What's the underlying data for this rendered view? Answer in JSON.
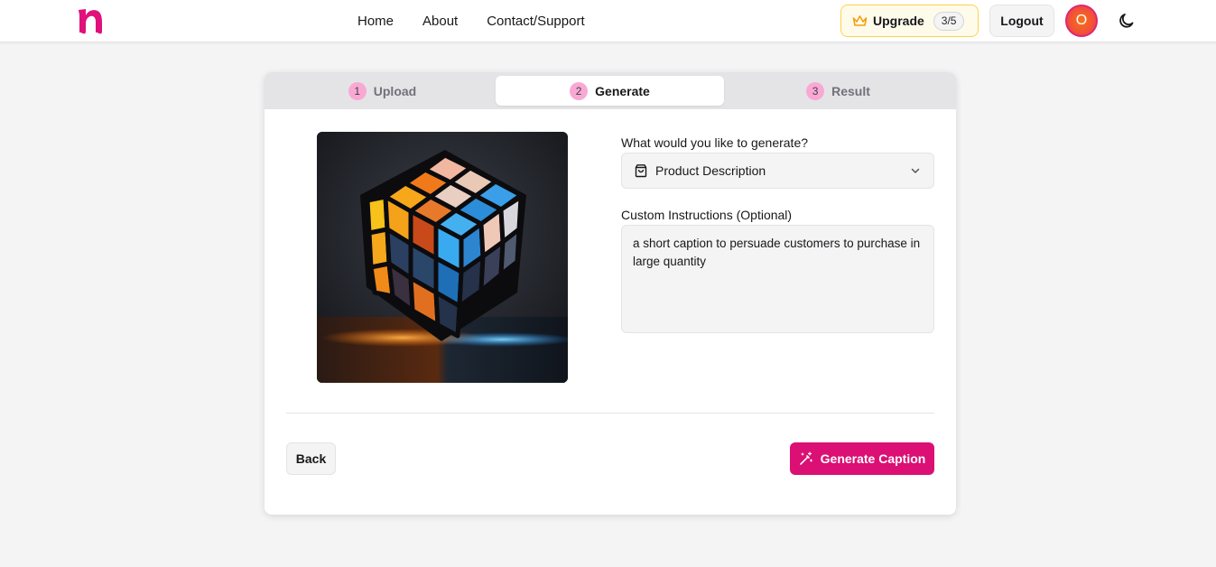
{
  "header": {
    "brand_colors": {
      "logo": "#e0117a",
      "accent": "#db0f74"
    },
    "nav": {
      "home": "Home",
      "about": "About",
      "contact": "Contact/Support"
    },
    "upgrade": {
      "label": "Upgrade",
      "count": "3/5",
      "icon": "crown-icon"
    },
    "logout_label": "Logout",
    "avatar_initial": "O",
    "theme_icon": "moon-icon"
  },
  "steps": [
    {
      "number": "1",
      "label": "Upload",
      "active": false
    },
    {
      "number": "2",
      "label": "Generate",
      "active": true
    },
    {
      "number": "3",
      "label": "Result",
      "active": false
    }
  ],
  "form": {
    "type_label": "What would you like to generate?",
    "type_value": "Product Description",
    "type_icon": "shopping-bag-icon",
    "instructions_label": "Custom Instructions (Optional)",
    "instructions_value": "a short caption to persuade customers to purchase in large quantity"
  },
  "actions": {
    "back_label": "Back",
    "generate_label": "Generate Caption",
    "generate_icon": "magic-wand-icon"
  }
}
